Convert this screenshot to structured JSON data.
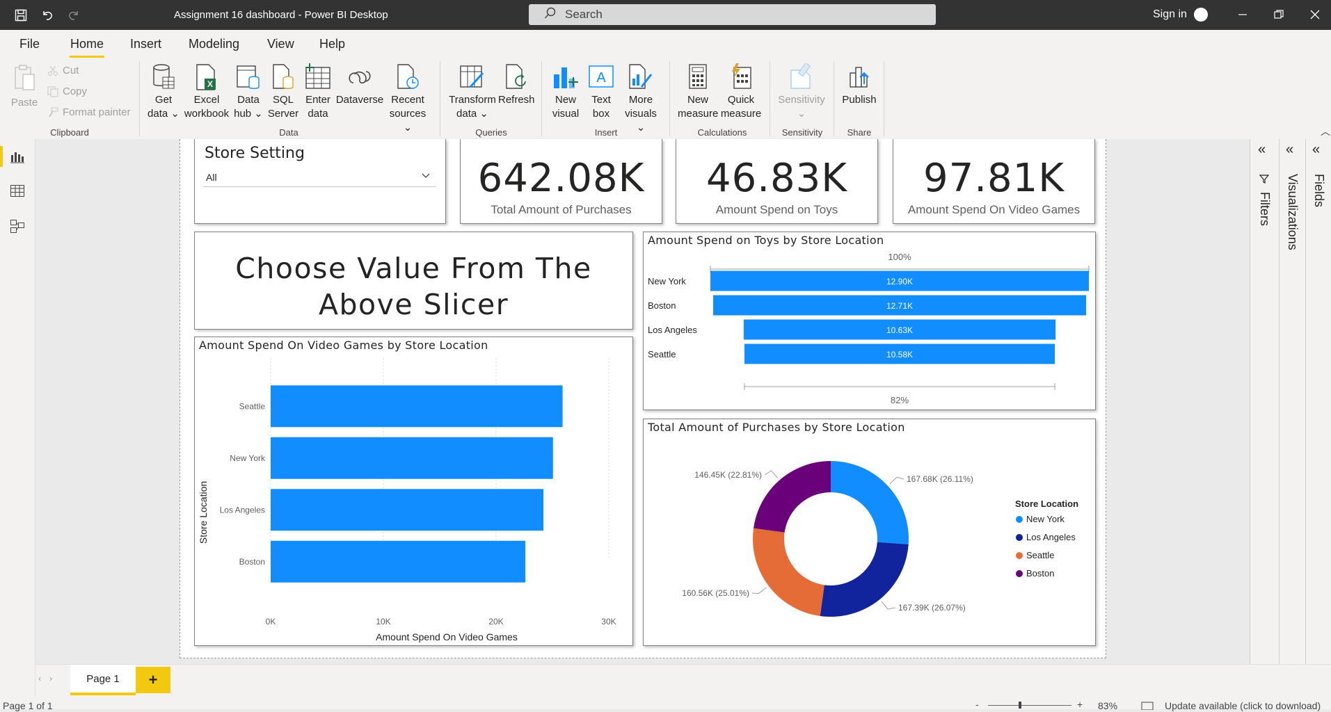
{
  "window": {
    "title": "Assignment 16 dashboard - Power BI Desktop",
    "search_placeholder": "Search",
    "sign_in": "Sign in"
  },
  "menu": {
    "tabs": [
      "File",
      "Home",
      "Insert",
      "Modeling",
      "View",
      "Help"
    ],
    "active": "Home"
  },
  "ribbon": {
    "clipboard": {
      "paste": "Paste",
      "cut": "Cut",
      "copy": "Copy",
      "format_painter": "Format painter",
      "group": "Clipboard"
    },
    "data": {
      "get_data": [
        "Get",
        "data"
      ],
      "excel": [
        "Excel",
        "workbook"
      ],
      "data_hub": [
        "Data",
        "hub"
      ],
      "sql": [
        "SQL",
        "Server"
      ],
      "enter_data": [
        "Enter",
        "data"
      ],
      "dataverse": "Dataverse",
      "recent": [
        "Recent",
        "sources"
      ],
      "group": "Data"
    },
    "queries": {
      "transform": [
        "Transform",
        "data"
      ],
      "refresh": "Refresh",
      "group": "Queries"
    },
    "insert": {
      "new_visual": [
        "New",
        "visual"
      ],
      "text_box": [
        "Text",
        "box"
      ],
      "more_visuals": [
        "More",
        "visuals"
      ],
      "group": "Insert"
    },
    "calculations": {
      "new_measure": [
        "New",
        "measure"
      ],
      "quick_measure": [
        "Quick",
        "measure"
      ],
      "group": "Calculations"
    },
    "sensitivity": {
      "label": "Sensitivity",
      "group": "Sensitivity"
    },
    "share": {
      "publish": "Publish",
      "group": "Share"
    }
  },
  "slicer": {
    "title": "Store Setting",
    "value": "All"
  },
  "kpis": [
    {
      "value": "642.08K",
      "label": "Total Amount of Purchases"
    },
    {
      "value": "46.83K",
      "label": "Amount Spend on Toys"
    },
    {
      "value": "97.81K",
      "label": "Amount Spend On Video Games"
    }
  ],
  "text_box": {
    "line1": "Choose Value From The",
    "line2": "Above Slicer"
  },
  "colors": {
    "accent": "#f2c811",
    "bar": "#118dff",
    "title_bar": "#333333",
    "ny": "#118dff",
    "la": "#12239e",
    "seattle": "#e66c37",
    "boston": "#6b007b"
  },
  "funnel": {
    "title": "Amount Spend on Toys by Store Location",
    "top_label": "100%",
    "bottom_label": "82%",
    "chart_data": {
      "type": "bar",
      "categories": [
        "New York",
        "Boston",
        "Los Angeles",
        "Seattle"
      ],
      "values": [
        12900,
        12710,
        10630,
        10580
      ],
      "data_labels": [
        "12.90K",
        "12.71K",
        "10.63K",
        "10.58K"
      ]
    }
  },
  "bar_chart": {
    "title": "Amount Spend On Video Games by Store Location",
    "chart_data": {
      "type": "bar",
      "categories": [
        "Seattle",
        "New York",
        "Los Angeles",
        "Boston"
      ],
      "values": [
        25900,
        25050,
        24200,
        22600
      ],
      "xlabel": "Amount Spend On Video Games",
      "ylabel": "Store Location",
      "xlim": [
        0,
        30000
      ],
      "ticks": [
        "0K",
        "10K",
        "20K",
        "30K"
      ],
      "tick_values": [
        0,
        10000,
        20000,
        30000
      ]
    }
  },
  "donut": {
    "title": "Total Amount of Purchases by Store Location",
    "legend_title": "Store Location",
    "chart_data": {
      "type": "pie",
      "categories": [
        "New York",
        "Los Angeles",
        "Seattle",
        "Boston"
      ],
      "values": [
        167680,
        167390,
        160560,
        146450
      ],
      "labels": [
        "167.68K (26.11%)",
        "167.39K (26.07%)",
        "160.56K (25.01%)",
        "146.45K (22.81%)"
      ],
      "colors": [
        "#118dff",
        "#12239e",
        "#e66c37",
        "#6b007b"
      ],
      "legend_placement": "right"
    }
  },
  "panes": {
    "filters": "Filters",
    "visualizations": "Visualizations",
    "fields": "Fields"
  },
  "pages": {
    "tab": "Page 1",
    "add": "+"
  },
  "status": {
    "page": "Page 1 of 1",
    "zoom": "83%",
    "update": "Update available (click to download)"
  }
}
